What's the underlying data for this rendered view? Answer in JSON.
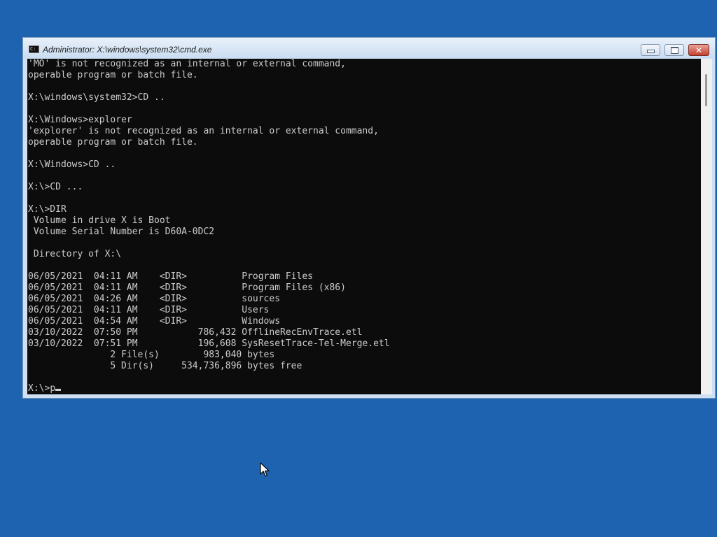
{
  "window": {
    "title": "Administrator: X:\\windows\\system32\\cmd.exe",
    "icon": "cmd-icon",
    "controls": {
      "minimize_icon": "minimize-icon",
      "maximize_icon": "maximize-icon",
      "close_icon": "close-icon"
    }
  },
  "console": {
    "lines": [
      "'MO' is not recognized as an internal or external command,",
      "operable program or batch file.",
      "",
      "X:\\windows\\system32>CD ..",
      "",
      "X:\\Windows>explorer",
      "'explorer' is not recognized as an internal or external command,",
      "operable program or batch file.",
      "",
      "X:\\Windows>CD ..",
      "",
      "X:\\>CD ...",
      "",
      "X:\\>DIR",
      " Volume in drive X is Boot",
      " Volume Serial Number is D60A-0DC2",
      "",
      " Directory of X:\\",
      "",
      "06/05/2021  04:11 AM    <DIR>          Program Files",
      "06/05/2021  04:11 AM    <DIR>          Program Files (x86)",
      "06/05/2021  04:26 AM    <DIR>          sources",
      "06/05/2021  04:11 AM    <DIR>          Users",
      "06/05/2021  04:54 AM    <DIR>          Windows",
      "03/10/2022  07:50 PM           786,432 OfflineRecEnvTrace.etl",
      "03/10/2022  07:51 PM           196,608 SysResetTrace-Tel-Merge.etl",
      "               2 File(s)        983,040 bytes",
      "               5 Dir(s)     534,736,896 bytes free",
      ""
    ],
    "prompt": "X:\\>",
    "typed_input": "p"
  },
  "colors": {
    "desktop": "#1e63b0",
    "console_bg": "#0c0c0c",
    "console_fg": "#cccccc"
  }
}
